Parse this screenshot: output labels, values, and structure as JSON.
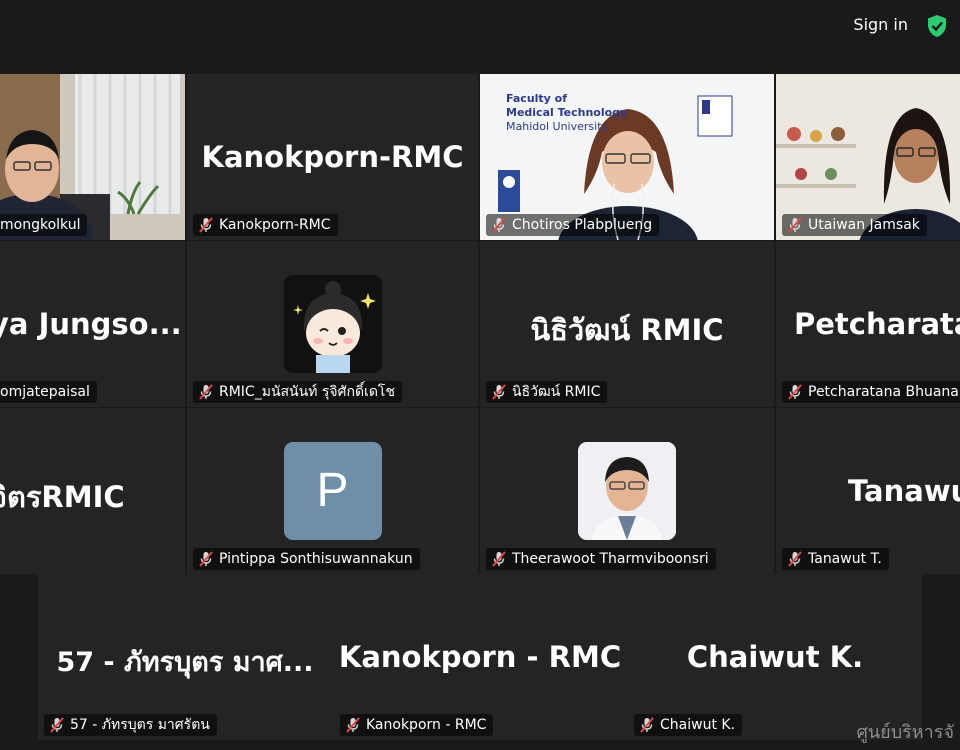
{
  "header": {
    "signin_label": "Sign in",
    "shield_icon": "shield-check-icon",
    "shield_color": "#2ecc71"
  },
  "tiles": {
    "t1": {
      "nametag": "mongkolkul"
    },
    "t2": {
      "big": "Kanokporn-RMC",
      "nametag": "Kanokporn-RMC"
    },
    "t3": {
      "nametag": "Chotiros Plabplueng",
      "bg_line1": "Faculty of",
      "bg_line2": "Medical Technology",
      "bg_line3": "Mahidol University"
    },
    "t4": {
      "nametag": "Utaiwan Jamsak"
    },
    "t5": {
      "big": "ya  Jungso...",
      "nametag": "omjatepaisal"
    },
    "t6": {
      "nametag": "RMIC_มนัสนันท์ รุจิศักดิ์เดโช"
    },
    "t7": {
      "big": "นิธิวัฒน์ RMIC",
      "nametag": "นิธิวัฒน์ RMIC"
    },
    "t8": {
      "big": "Petcharatana",
      "nametag": "Petcharatana Bhuanan"
    },
    "t9": {
      "big": "จิตรRMIC"
    },
    "t10": {
      "avatar_letter": "P",
      "avatar_color": "#6f8fa8",
      "nametag": "Pintippa Sonthisuwannakun"
    },
    "t11": {
      "nametag": "Theerawoot Tharmviboonsri"
    },
    "t12": {
      "big": "Tanawut",
      "nametag": "Tanawut T."
    },
    "t13": {
      "big": "57 - ภัทรบุตร มาศ...",
      "nametag": "57 - ภัทรบุตร มาศรัตน"
    },
    "t14": {
      "big": "Kanokporn - RMC",
      "nametag": "Kanokporn - RMC"
    },
    "t15": {
      "big": "Chaiwut K.",
      "nametag": "Chaiwut K."
    }
  },
  "watermark": "ศูนย์บริหารจั",
  "colors": {
    "active_speaker_border": "#7fe07f",
    "mic_muted": "#e04848"
  }
}
